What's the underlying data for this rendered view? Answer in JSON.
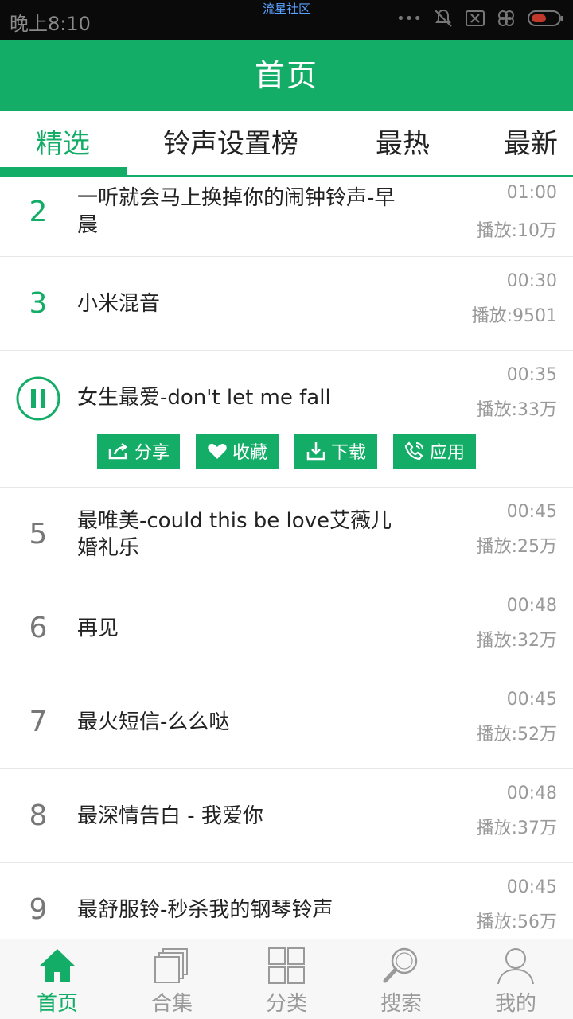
{
  "status_bar": {
    "time": "晚上8:10",
    "carrier": "流星社区"
  },
  "header": {
    "title": "首页"
  },
  "tabs": [
    {
      "label": "精选",
      "active": true
    },
    {
      "label": "铃声设置榜",
      "active": false
    },
    {
      "label": "最热",
      "active": false
    },
    {
      "label": "最新",
      "active": false
    }
  ],
  "songs": [
    {
      "rank": "2",
      "title": "一听就会马上换掉你的闹钟铃声-早晨",
      "duration": "01:00",
      "plays": "播放:10万"
    },
    {
      "rank": "3",
      "title": "小米混音",
      "duration": "00:30",
      "plays": "播放:9501"
    },
    {
      "rank": "",
      "title": "女生最爱-don't let me fall",
      "duration": "00:35",
      "plays": "播放:33万",
      "playing": true
    },
    {
      "rank": "5",
      "title": "最唯美-could this be love艾薇儿婚礼乐",
      "duration": "00:45",
      "plays": "播放:25万"
    },
    {
      "rank": "6",
      "title": "再见",
      "duration": "00:48",
      "plays": "播放:32万"
    },
    {
      "rank": "7",
      "title": "最火短信-么么哒",
      "duration": "00:45",
      "plays": "播放:52万"
    },
    {
      "rank": "8",
      "title": "最深情告白 - 我爱你",
      "duration": "00:48",
      "plays": "播放:37万"
    },
    {
      "rank": "9",
      "title": "最舒服铃-秒杀我的钢琴铃声",
      "duration": "00:45",
      "plays": "播放:56万"
    }
  ],
  "actions": {
    "share": "分享",
    "favorite": "收藏",
    "download": "下载",
    "apply": "应用"
  },
  "bottom_nav": [
    {
      "label": "首页",
      "icon": "home-icon",
      "active": true
    },
    {
      "label": "合集",
      "icon": "collection-icon",
      "active": false
    },
    {
      "label": "分类",
      "icon": "category-grid-icon",
      "active": false
    },
    {
      "label": "搜索",
      "icon": "search-icon",
      "active": false
    },
    {
      "label": "我的",
      "icon": "profile-icon",
      "active": false
    }
  ],
  "colors": {
    "accent": "#13ad67",
    "text": "#222222",
    "muted": "#999999"
  }
}
